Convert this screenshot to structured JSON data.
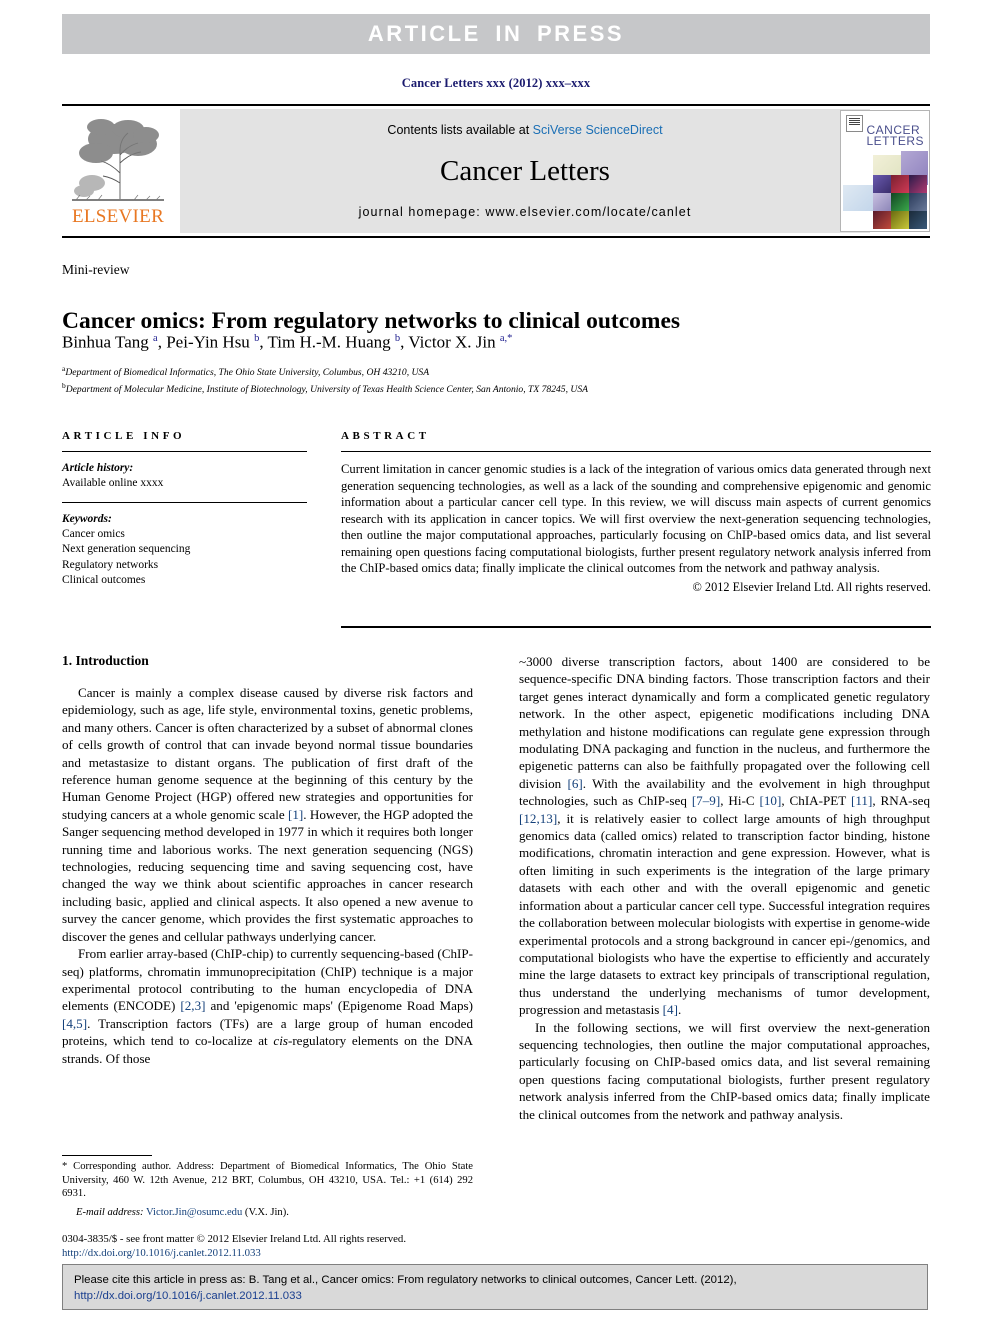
{
  "banner": {
    "text": "ARTICLE IN PRESS"
  },
  "running_head": "Cancer Letters xxx (2012) xxx–xxx",
  "masthead": {
    "contents_prefix": "Contents lists available at ",
    "contents_link": "SciVerse ScienceDirect",
    "journal_title": "Cancer Letters",
    "homepage": "journal homepage: www.elsevier.com/locate/canlet",
    "publisher_name": "ELSEVIER",
    "cover_title_line1": "CANCER",
    "cover_title_line2": "LETTERS"
  },
  "article": {
    "doctype": "Mini-review",
    "title": "Cancer omics: From regulatory networks to clinical outcomes",
    "authors_html": "Binhua Tang <sup>a</sup>, Pei-Yin Hsu <sup>b</sup>, Tim H.-M. Huang <sup>b</sup>, Victor X. Jin <sup>a,*</sup>",
    "affiliation_a": "Department of Biomedical Informatics, The Ohio State University, Columbus, OH 43210, USA",
    "affiliation_b": "Department of Molecular Medicine, Institute of Biotechnology, University of Texas Health Science Center, San Antonio, TX 78245, USA"
  },
  "article_info": {
    "heading": "ARTICLE INFO",
    "history_label": "Article history:",
    "history_value": "Available online xxxx",
    "keywords_label": "Keywords:",
    "keywords": [
      "Cancer omics",
      "Next generation sequencing",
      "Regulatory networks",
      "Clinical outcomes"
    ]
  },
  "abstract": {
    "heading": "ABSTRACT",
    "text": "Current limitation in cancer genomic studies is a lack of the integration of various omics data generated through next generation sequencing technologies, as well as a lack of the sounding and comprehensive epigenomic and genomic information about a particular cancer cell type. In this review, we will discuss main aspects of current genomics research with its application in cancer topics. We will first overview the next-generation sequencing technologies, then outline the major computational approaches, particularly focusing on ChIP-based omics data, and list several remaining open questions facing computational biologists, further present regulatory network analysis inferred from the ChIP-based omics data; finally implicate the clinical outcomes from the network and pathway analysis.",
    "copyright": "© 2012 Elsevier Ireland Ltd. All rights reserved."
  },
  "body": {
    "section_heading": "1. Introduction",
    "paragraphs": [
      "Cancer is mainly a complex disease caused by diverse risk factors and epidemiology, such as age, life style, environmental toxins, genetic problems, and many others. Cancer is often characterized by a subset of abnormal clones of cells growth of control that can invade beyond normal tissue boundaries and metastasize to distant organs. The publication of first draft of the reference human genome sequence at the beginning of this century by the Human Genome Project (HGP) offered new strategies and opportunities for studying cancers at a whole genomic scale [1]. However, the HGP adopted the Sanger sequencing method developed in 1977 in which it requires both longer running time and laborious works. The next generation sequencing (NGS) technologies, reducing sequencing time and saving sequencing cost, have changed the way we think about scientific approaches in cancer research including basic, applied and clinical aspects. It also opened a new avenue to survey the cancer genome, which provides the first systematic approaches to discover the genes and cellular pathways underlying cancer.",
      "From earlier array-based (ChIP-chip) to currently sequencing-based (ChIP-seq) platforms, chromatin immunoprecipitation (ChIP) technique is a major experimental protocol contributing to the human encyclopedia of DNA elements (ENCODE) [2,3] and 'epigenomic maps' (Epigenome Road Maps) [4,5]. Transcription factors (TFs) are a large group of human encoded proteins, which tend to co-localize at cis-regulatory elements on the DNA strands. Of those",
      "~3000 diverse transcription factors, about 1400 are considered to be sequence-specific DNA binding factors. Those transcription factors and their target genes interact dynamically and form a complicated genetic regulatory network. In the other aspect, epigenetic modifications including DNA methylation and histone modifications can regulate gene expression through modulating DNA packaging and function in the nucleus, and furthermore the epigenetic patterns can also be faithfully propagated over the following cell division [6]. With the availability and the evolvement in high throughput technologies, such as ChIP-seq [7–9], Hi-C [10], ChIA-PET [11], RNA-seq [12,13], it is relatively easier to collect large amounts of high throughput genomics data (called omics) related to transcription factor binding, histone modifications, chromatin interaction and gene expression. However, what is often limiting in such experiments is the integration of the large primary datasets with each other and with the overall epigenomic and genetic information about a particular cancer cell type. Successful integration requires the collaboration between molecular biologists with expertise in genome-wide experimental protocols and a strong background in cancer epi-/genomics, and computational biologists who have the expertise to efficiently and accurately mine the large datasets to extract key principals of transcriptional regulation, thus understand the underlying mechanisms of tumor development, progression and metastasis [4].",
      "In the following sections, we will first overview the next-generation sequencing technologies, then outline the major computational approaches, particularly focusing on ChIP-based omics data, and list several remaining open questions facing computational biologists, further present regulatory network analysis inferred from the ChIP-based omics data; finally implicate the clinical outcomes from the network and pathway analysis."
    ]
  },
  "footnote": {
    "corresponding": "* Corresponding author. Address: Department of Biomedical Informatics, The Ohio State University, 460 W. 12th Avenue, 212 BRT, Columbus, OH 43210, USA. Tel.: +1 (614) 292 6931.",
    "email_label": "E-mail address:",
    "email": "Victor.Jin@osumc.edu",
    "email_suffix": "(V.X. Jin)."
  },
  "imprint": {
    "line1": "0304-3835/$ - see front matter © 2012 Elsevier Ireland Ltd. All rights reserved.",
    "doi": "http://dx.doi.org/10.1016/j.canlet.2012.11.033"
  },
  "cite_box": {
    "text": "Please cite this article in press as: B. Tang et al., Cancer omics: From regulatory networks to clinical outcomes, Cancer Lett. (2012), ",
    "doi": "http://dx.doi.org/10.1016/j.canlet.2012.11.033"
  },
  "colors": {
    "banner_bg": "#c6c7c9",
    "link": "#1b6fb5",
    "reference": "#14407a",
    "running_head": "#1a1a6e",
    "elsevier_orange": "#E87722",
    "cite_box_bg": "#d9d9d9"
  }
}
